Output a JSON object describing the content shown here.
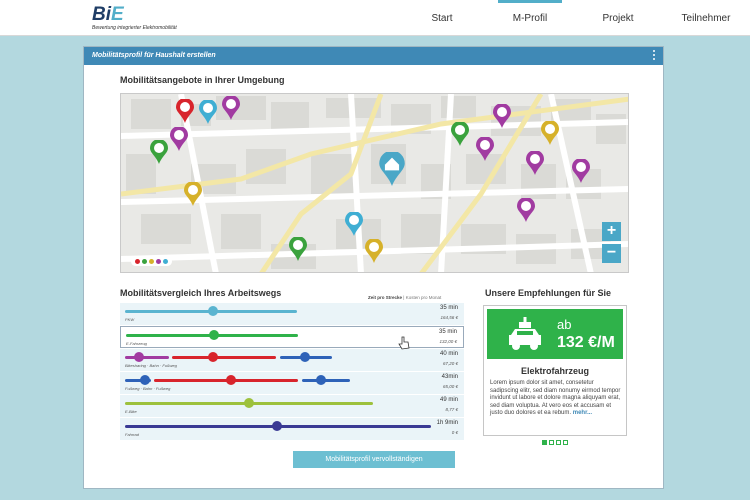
{
  "header": {
    "logo_main": "Bi",
    "logo_accent": "E",
    "logo_sub": "Bewertung integrierter Elektromobilität",
    "nav": [
      {
        "label": "Start",
        "active": false
      },
      {
        "label": "M-Profil",
        "active": true
      },
      {
        "label": "Projekt",
        "active": false
      },
      {
        "label": "Teilnehmer",
        "active": false
      }
    ]
  },
  "card": {
    "title": "Mobilitätsprofil für Haushalt erstellen"
  },
  "map_section": {
    "title": "Mobilitätsangebote in Ihrer Umgebung",
    "zoom_in": "+",
    "zoom_out": "−"
  },
  "comparison": {
    "title": "Mobilitätsvergleich Ihres Arbeitswegs",
    "sort_time": "Zeit pro Strecke",
    "sort_separator": "|",
    "sort_cost": "Kosten pro Monat",
    "rows": [
      {
        "label": "PKW",
        "time": "35 min",
        "cost": "164,56 €"
      },
      {
        "label": "E-Fahrzeug",
        "time": "35 min",
        "cost": "132,00 €"
      },
      {
        "label": "Bikesharing · Bahn · Fußweg",
        "time": "40 min",
        "cost": "67,20 €"
      },
      {
        "label": "Fußweg · Bahn · Fußweg",
        "time": "43min",
        "cost": "65,00 €"
      },
      {
        "label": "E-Bike",
        "time": "49 min",
        "cost": "8,77 €"
      },
      {
        "label": "Fahrrad",
        "time": "1h 9min",
        "cost": "0 €"
      }
    ]
  },
  "recommendation": {
    "title": "Unsere Empfehlungen für Sie",
    "from": "ab",
    "price": "132 €/M",
    "name": "Elektrofahrzeug",
    "text": "Lorem ipsum dolor sit amet, consetetur sadipscing elitr, sed diam nonumy eirmod tempor invidunt ut labore et dolore magna aliquyam erat, sed diam voluptua. At vero eos et accusam et justo duo dolores et ea rebum.",
    "more": "mehr..."
  },
  "cta": {
    "label": "Mobilitätsprofil vervollständigen"
  },
  "colors": {
    "primary": "#3f89b6",
    "accent": "#52aec9",
    "green": "#2fb24a"
  }
}
